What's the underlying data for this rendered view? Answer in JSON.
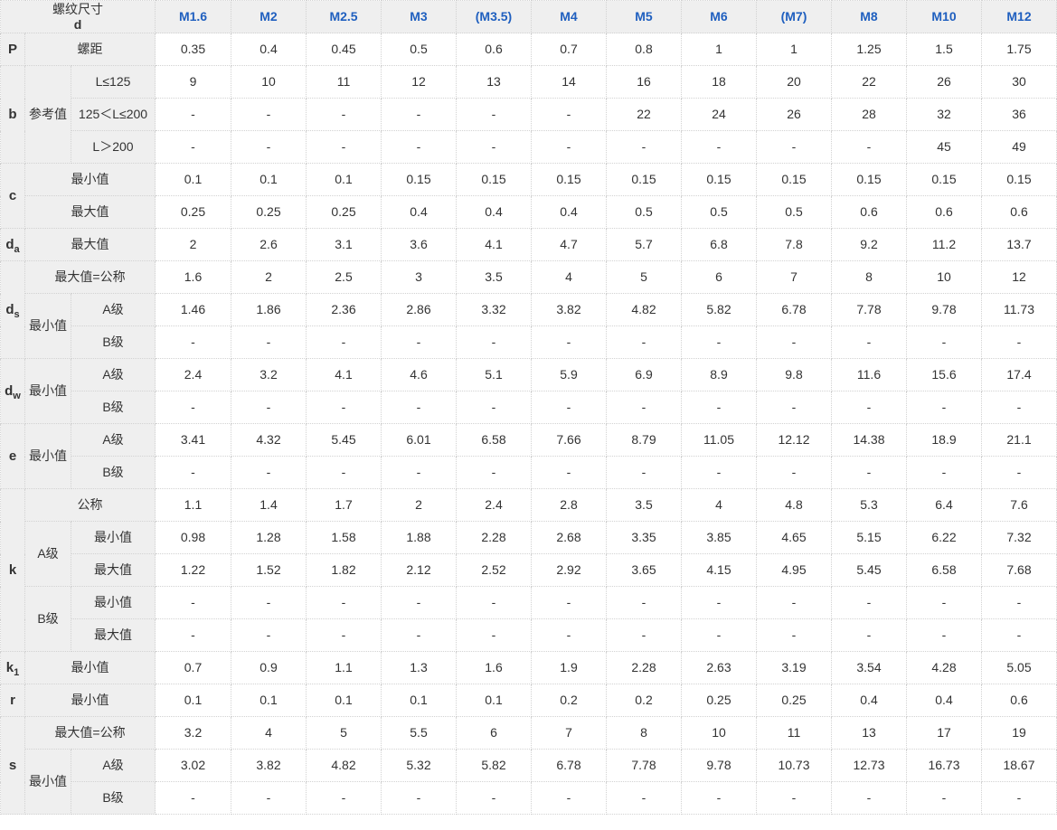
{
  "header": {
    "corner_line1": "螺纹尺寸",
    "corner_line2": "d",
    "sizes": [
      "M1.6",
      "M2",
      "M2.5",
      "M3",
      "(M3.5)",
      "M4",
      "M5",
      "M6",
      "(M7)",
      "M8",
      "M10",
      "M12"
    ]
  },
  "rows": {
    "P": {
      "sym": "P",
      "label": "螺距",
      "values": [
        "0.35",
        "0.4",
        "0.45",
        "0.5",
        "0.6",
        "0.7",
        "0.8",
        "1",
        "1",
        "1.25",
        "1.5",
        "1.75"
      ]
    },
    "b": {
      "sym": "b",
      "group": "参考值",
      "r1": {
        "label": "L≤125",
        "values": [
          "9",
          "10",
          "11",
          "12",
          "13",
          "14",
          "16",
          "18",
          "20",
          "22",
          "26",
          "30"
        ]
      },
      "r2": {
        "label": "125＜L≤200",
        "values": [
          "-",
          "-",
          "-",
          "-",
          "-",
          "-",
          "22",
          "24",
          "26",
          "28",
          "32",
          "36"
        ]
      },
      "r3": {
        "label": "L＞200",
        "values": [
          "-",
          "-",
          "-",
          "-",
          "-",
          "-",
          "-",
          "-",
          "-",
          "-",
          "45",
          "49"
        ]
      }
    },
    "c": {
      "sym": "c",
      "min": {
        "label": "最小值",
        "values": [
          "0.1",
          "0.1",
          "0.1",
          "0.15",
          "0.15",
          "0.15",
          "0.15",
          "0.15",
          "0.15",
          "0.15",
          "0.15",
          "0.15"
        ]
      },
      "max": {
        "label": "最大值",
        "values": [
          "0.25",
          "0.25",
          "0.25",
          "0.4",
          "0.4",
          "0.4",
          "0.5",
          "0.5",
          "0.5",
          "0.6",
          "0.6",
          "0.6"
        ]
      }
    },
    "da": {
      "sym": "d",
      "sub": "a",
      "label": "最大值",
      "values": [
        "2",
        "2.6",
        "3.1",
        "3.6",
        "4.1",
        "4.7",
        "5.7",
        "6.8",
        "7.8",
        "9.2",
        "11.2",
        "13.7"
      ]
    },
    "ds": {
      "sym": "d",
      "sub": "s",
      "nom": {
        "label": "最大值=公称",
        "values": [
          "1.6",
          "2",
          "2.5",
          "3",
          "3.5",
          "4",
          "5",
          "6",
          "7",
          "8",
          "10",
          "12"
        ]
      },
      "group": "最小值",
      "a": {
        "label": "A级",
        "values": [
          "1.46",
          "1.86",
          "2.36",
          "2.86",
          "3.32",
          "3.82",
          "4.82",
          "5.82",
          "6.78",
          "7.78",
          "9.78",
          "11.73"
        ]
      },
      "b": {
        "label": "B级",
        "values": [
          "-",
          "-",
          "-",
          "-",
          "-",
          "-",
          "-",
          "-",
          "-",
          "-",
          "-",
          "-"
        ]
      }
    },
    "dw": {
      "sym": "d",
      "sub": "w",
      "group": "最小值",
      "a": {
        "label": "A级",
        "values": [
          "2.4",
          "3.2",
          "4.1",
          "4.6",
          "5.1",
          "5.9",
          "6.9",
          "8.9",
          "9.8",
          "11.6",
          "15.6",
          "17.4"
        ]
      },
      "b": {
        "label": "B级",
        "values": [
          "-",
          "-",
          "-",
          "-",
          "-",
          "-",
          "-",
          "-",
          "-",
          "-",
          "-",
          "-"
        ]
      }
    },
    "e": {
      "sym": "e",
      "group": "最小值",
      "a": {
        "label": "A级",
        "values": [
          "3.41",
          "4.32",
          "5.45",
          "6.01",
          "6.58",
          "7.66",
          "8.79",
          "11.05",
          "12.12",
          "14.38",
          "18.9",
          "21.1"
        ]
      },
      "b": {
        "label": "B级",
        "values": [
          "-",
          "-",
          "-",
          "-",
          "-",
          "-",
          "-",
          "-",
          "-",
          "-",
          "-",
          "-"
        ]
      }
    },
    "k": {
      "sym": "k",
      "nom": {
        "label": "公称",
        "values": [
          "1.1",
          "1.4",
          "1.7",
          "2",
          "2.4",
          "2.8",
          "3.5",
          "4",
          "4.8",
          "5.3",
          "6.4",
          "7.6"
        ]
      },
      "ga": "A级",
      "amin": {
        "label": "最小值",
        "values": [
          "0.98",
          "1.28",
          "1.58",
          "1.88",
          "2.28",
          "2.68",
          "3.35",
          "3.85",
          "4.65",
          "5.15",
          "6.22",
          "7.32"
        ]
      },
      "amax": {
        "label": "最大值",
        "values": [
          "1.22",
          "1.52",
          "1.82",
          "2.12",
          "2.52",
          "2.92",
          "3.65",
          "4.15",
          "4.95",
          "5.45",
          "6.58",
          "7.68"
        ]
      },
      "gb": "B级",
      "bmin": {
        "label": "最小值",
        "values": [
          "-",
          "-",
          "-",
          "-",
          "-",
          "-",
          "-",
          "-",
          "-",
          "-",
          "-",
          "-"
        ]
      },
      "bmax": {
        "label": "最大值",
        "values": [
          "-",
          "-",
          "-",
          "-",
          "-",
          "-",
          "-",
          "-",
          "-",
          "-",
          "-",
          "-"
        ]
      }
    },
    "k1": {
      "sym": "k",
      "sub": "1",
      "label": "最小值",
      "values": [
        "0.7",
        "0.9",
        "1.1",
        "1.3",
        "1.6",
        "1.9",
        "2.28",
        "2.63",
        "3.19",
        "3.54",
        "4.28",
        "5.05"
      ]
    },
    "r": {
      "sym": "r",
      "label": "最小值",
      "values": [
        "0.1",
        "0.1",
        "0.1",
        "0.1",
        "0.1",
        "0.2",
        "0.2",
        "0.25",
        "0.25",
        "0.4",
        "0.4",
        "0.6"
      ]
    },
    "s": {
      "sym": "s",
      "nom": {
        "label": "最大值=公称",
        "values": [
          "3.2",
          "4",
          "5",
          "5.5",
          "6",
          "7",
          "8",
          "10",
          "11",
          "13",
          "17",
          "19"
        ]
      },
      "group": "最小值",
      "a": {
        "label": "A级",
        "values": [
          "3.02",
          "3.82",
          "4.82",
          "5.32",
          "5.82",
          "6.78",
          "7.78",
          "9.78",
          "10.73",
          "12.73",
          "16.73",
          "18.67"
        ]
      },
      "b": {
        "label": "B级",
        "values": [
          "-",
          "-",
          "-",
          "-",
          "-",
          "-",
          "-",
          "-",
          "-",
          "-",
          "-",
          "-"
        ]
      }
    }
  }
}
